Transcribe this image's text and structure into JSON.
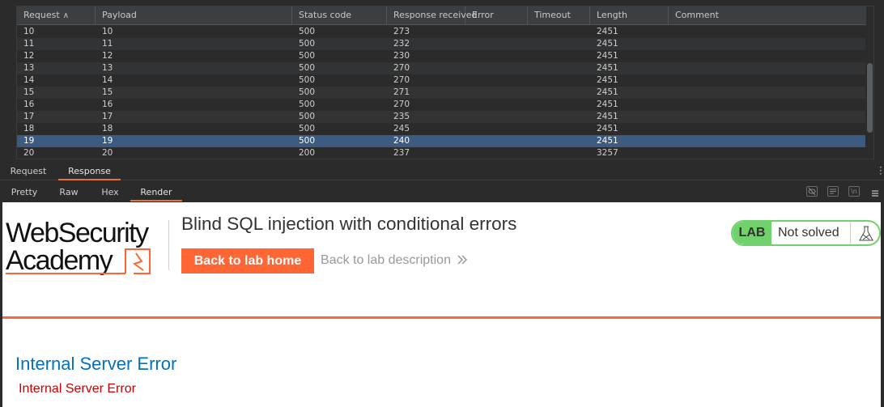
{
  "results_table": {
    "columns": [
      {
        "label": "Request",
        "sort": "ascending"
      },
      {
        "label": "Payload"
      },
      {
        "label": "Status code"
      },
      {
        "label": "Response received"
      },
      {
        "label": "Error"
      },
      {
        "label": "Timeout"
      },
      {
        "label": "Length"
      },
      {
        "label": "Comment"
      }
    ],
    "rows": [
      {
        "request": "10",
        "payload": "10",
        "status": "500",
        "received": "273",
        "error": "",
        "timeout": "",
        "length": "2451",
        "comment": ""
      },
      {
        "request": "11",
        "payload": "11",
        "status": "500",
        "received": "232",
        "error": "",
        "timeout": "",
        "length": "2451",
        "comment": ""
      },
      {
        "request": "12",
        "payload": "12",
        "status": "500",
        "received": "230",
        "error": "",
        "timeout": "",
        "length": "2451",
        "comment": ""
      },
      {
        "request": "13",
        "payload": "13",
        "status": "500",
        "received": "270",
        "error": "",
        "timeout": "",
        "length": "2451",
        "comment": ""
      },
      {
        "request": "14",
        "payload": "14",
        "status": "500",
        "received": "270",
        "error": "",
        "timeout": "",
        "length": "2451",
        "comment": ""
      },
      {
        "request": "15",
        "payload": "15",
        "status": "500",
        "received": "271",
        "error": "",
        "timeout": "",
        "length": "2451",
        "comment": ""
      },
      {
        "request": "16",
        "payload": "16",
        "status": "500",
        "received": "270",
        "error": "",
        "timeout": "",
        "length": "2451",
        "comment": ""
      },
      {
        "request": "17",
        "payload": "17",
        "status": "500",
        "received": "235",
        "error": "",
        "timeout": "",
        "length": "2451",
        "comment": ""
      },
      {
        "request": "18",
        "payload": "18",
        "status": "500",
        "received": "245",
        "error": "",
        "timeout": "",
        "length": "2451",
        "comment": ""
      },
      {
        "request": "19",
        "payload": "19",
        "status": "500",
        "received": "240",
        "error": "",
        "timeout": "",
        "length": "2451",
        "comment": "",
        "selected": true
      },
      {
        "request": "20",
        "payload": "20",
        "status": "200",
        "received": "237",
        "error": "",
        "timeout": "",
        "length": "3257",
        "comment": ""
      }
    ]
  },
  "message_tabs": {
    "items": [
      "Request",
      "Response"
    ],
    "active": "Response"
  },
  "view_tabs": {
    "items": [
      "Pretty",
      "Raw",
      "Hex",
      "Render"
    ],
    "active": "Render",
    "tool_icons": [
      "hide-eye-icon",
      "wrap-lines-icon",
      "newline-icon",
      "menu-icon"
    ]
  },
  "rendered_page": {
    "logo_lines": [
      "WebSecurity",
      "Academy"
    ],
    "title": "Blind SQL injection with conditional errors",
    "back_home_label": "Back to lab home",
    "back_description_label": "Back to lab description",
    "lab_badge_label": "LAB",
    "lab_status": "Not solved",
    "error_heading": "Internal Server Error",
    "error_message": "Internal Server Error",
    "colors": {
      "accent_orange": "#ff6633",
      "lab_green": "#70d16d",
      "heading_blue": "#0071bc",
      "error_red": "#cc0000",
      "selection_blue": "#3d5a80"
    }
  }
}
